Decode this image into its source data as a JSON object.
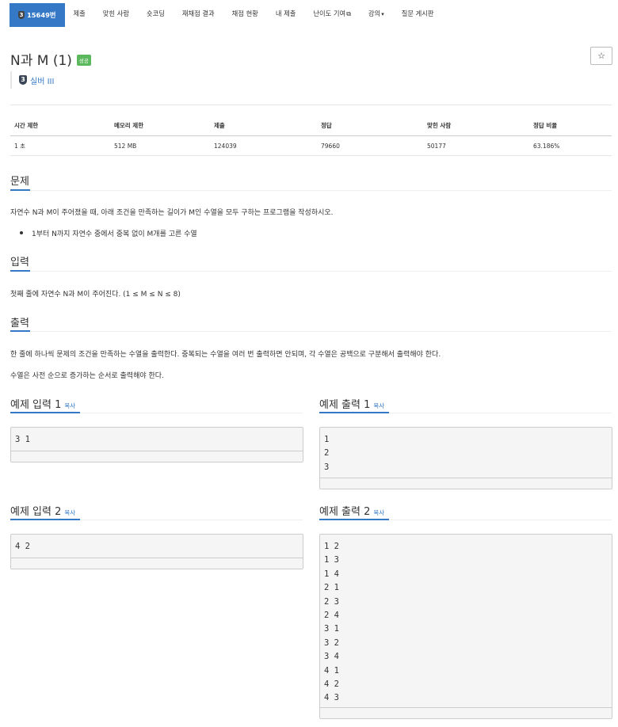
{
  "tabs": {
    "active_num": "15649번",
    "tier_mini": "3",
    "submit": "제출",
    "solved": "맞힌 사람",
    "shortcoding": "숏코딩",
    "rejudge": "재채점 결과",
    "status": "채점 현황",
    "my_submit": "내 제출",
    "difficulty": "난이도 기여",
    "lecture": "강의",
    "board": "질문 게시판"
  },
  "problem": {
    "title": "N과 M (1)",
    "badge": "성공",
    "star": "☆",
    "tier_number": "3",
    "tier_label": "실버 III"
  },
  "info": {
    "headers": [
      "시간 제한",
      "메모리 제한",
      "제출",
      "정답",
      "맞힌 사람",
      "정답 비율"
    ],
    "values": [
      "1 초",
      "512 MB",
      "124039",
      "79660",
      "50177",
      "63.186%"
    ]
  },
  "sections": {
    "problem_title": "문제",
    "problem_text": "자연수 N과 M이 주어졌을 때, 아래 조건을 만족하는 길이가 M인 수열을 모두 구하는 프로그램을 작성하시오.",
    "problem_bullet": "1부터 N까지 자연수 중에서 중복 없이 M개를 고른 수열",
    "input_title": "입력",
    "input_text": "첫째 줄에 자연수 N과 M이 주어진다. (1 ≤ M ≤ N ≤ 8)",
    "output_title": "출력",
    "output_text1": "한 줄에 하나씩 문제의 조건을 만족하는 수열을 출력한다. 중복되는 수열을 여러 번 출력하면 안되며, 각 수열은 공백으로 구분해서 출력해야 한다.",
    "output_text2": "수열은 사전 순으로 증가하는 순서로 출력해야 한다."
  },
  "examples": {
    "copy_label": "복사",
    "in1_title": "예제 입력 1",
    "out1_title": "예제 출력 1",
    "in2_title": "예제 입력 2",
    "out2_title": "예제 출력 2",
    "in1": "3 1",
    "out1": "1\n2\n3",
    "in2": "4 2",
    "out2": "1 2\n1 3\n1 4\n2 1\n2 3\n2 4\n3 1\n3 2\n3 4\n4 1\n4 2\n4 3"
  }
}
